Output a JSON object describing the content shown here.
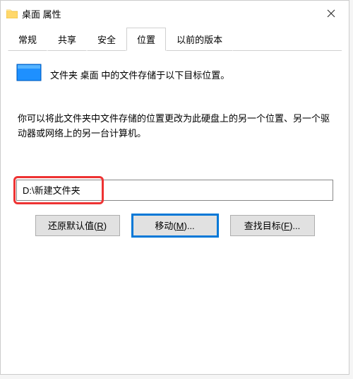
{
  "window": {
    "title": "桌面 属性"
  },
  "tabs": [
    {
      "label": "常规"
    },
    {
      "label": "共享"
    },
    {
      "label": "安全"
    },
    {
      "label": "位置"
    },
    {
      "label": "以前的版本"
    }
  ],
  "location_tab": {
    "intro": "文件夹 桌面 中的文件存储于以下目标位置。",
    "description": "你可以将此文件夹中文件存储的位置更改为此硬盘上的另一个位置、另一个驱动器或网络上的另一台计算机。",
    "path_value": "D:\\新建文件夹",
    "buttons": {
      "restore": {
        "label": "还原默认值(",
        "mnemonic": "R",
        "suffix": ")"
      },
      "move": {
        "label": "移动(",
        "mnemonic": "M",
        "suffix": ")..."
      },
      "find": {
        "label": "查找目标(",
        "mnemonic": "F",
        "suffix": ")..."
      }
    }
  },
  "icons": {
    "folder": "folder-icon",
    "desktop": "desktop-icon",
    "close": "close-icon"
  }
}
